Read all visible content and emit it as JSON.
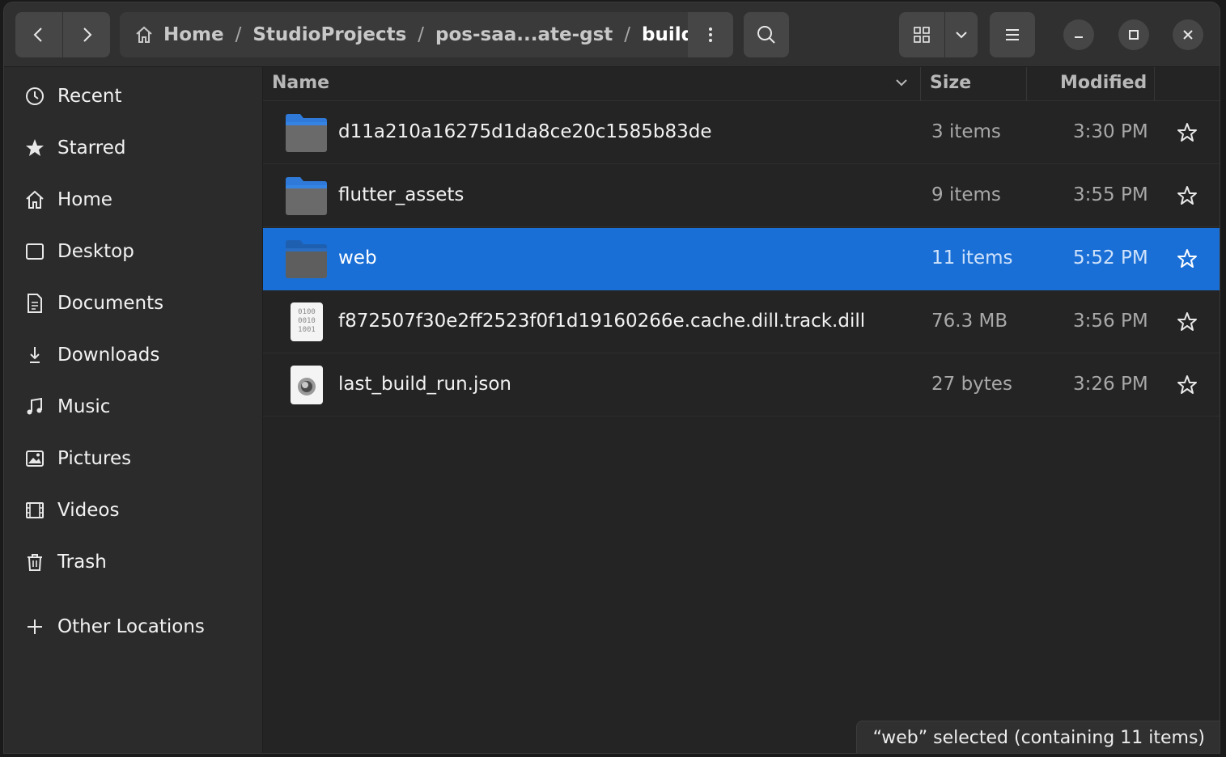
{
  "header": {
    "breadcrumbs": [
      {
        "label": "Home"
      },
      {
        "label": "StudioProjects"
      },
      {
        "label": "pos-saa...ate-gst"
      },
      {
        "label": "build"
      }
    ],
    "separator": "/",
    "icons": {
      "back": "chevron-left-icon",
      "forward": "chevron-right-icon",
      "home": "home-icon",
      "path_menu": "vertical-dots-icon",
      "search": "search-icon",
      "view_grid": "grid-view-icon",
      "view_dropdown": "chevron-down-icon",
      "main_menu": "hamburger-menu-icon",
      "minimize": "minimize-icon",
      "maximize": "maximize-icon",
      "close": "close-icon"
    }
  },
  "sidebar": {
    "items": [
      {
        "label": "Recent",
        "icon": "clock-icon"
      },
      {
        "label": "Starred",
        "icon": "star-icon"
      },
      {
        "label": "Home",
        "icon": "home-icon"
      },
      {
        "label": "Desktop",
        "icon": "desktop-icon"
      },
      {
        "label": "Documents",
        "icon": "document-icon"
      },
      {
        "label": "Downloads",
        "icon": "download-icon"
      },
      {
        "label": "Music",
        "icon": "music-icon"
      },
      {
        "label": "Pictures",
        "icon": "picture-icon"
      },
      {
        "label": "Videos",
        "icon": "video-icon"
      },
      {
        "label": "Trash",
        "icon": "trash-icon"
      },
      {
        "label": "Other Locations",
        "icon": "plus-icon"
      }
    ]
  },
  "columns": {
    "name": "Name",
    "size": "Size",
    "modified": "Modified"
  },
  "files": [
    {
      "name": "d11a210a16275d1da8ce20c1585b83de",
      "size": "3 items",
      "modified": "3:30 PM",
      "type": "folder",
      "selected": false
    },
    {
      "name": "flutter_assets",
      "size": "9 items",
      "modified": "3:55 PM",
      "type": "folder",
      "selected": false
    },
    {
      "name": "web",
      "size": "11 items",
      "modified": "5:52 PM",
      "type": "folder",
      "selected": true
    },
    {
      "name": "f872507f30e2ff2523f0f1d19160266e.cache.dill.track.dill",
      "size": "76.3 MB",
      "modified": "3:56 PM",
      "type": "binary",
      "selected": false
    },
    {
      "name": "last_build_run.json",
      "size": "27 bytes",
      "modified": "3:26 PM",
      "type": "json",
      "selected": false
    }
  ],
  "status": {
    "text": "“web” selected  (containing 11 items)"
  },
  "colors": {
    "selection": "#1a6fd6",
    "folder": "#3584e4",
    "background": "#242424",
    "sidebar": "#2b2b2b"
  }
}
